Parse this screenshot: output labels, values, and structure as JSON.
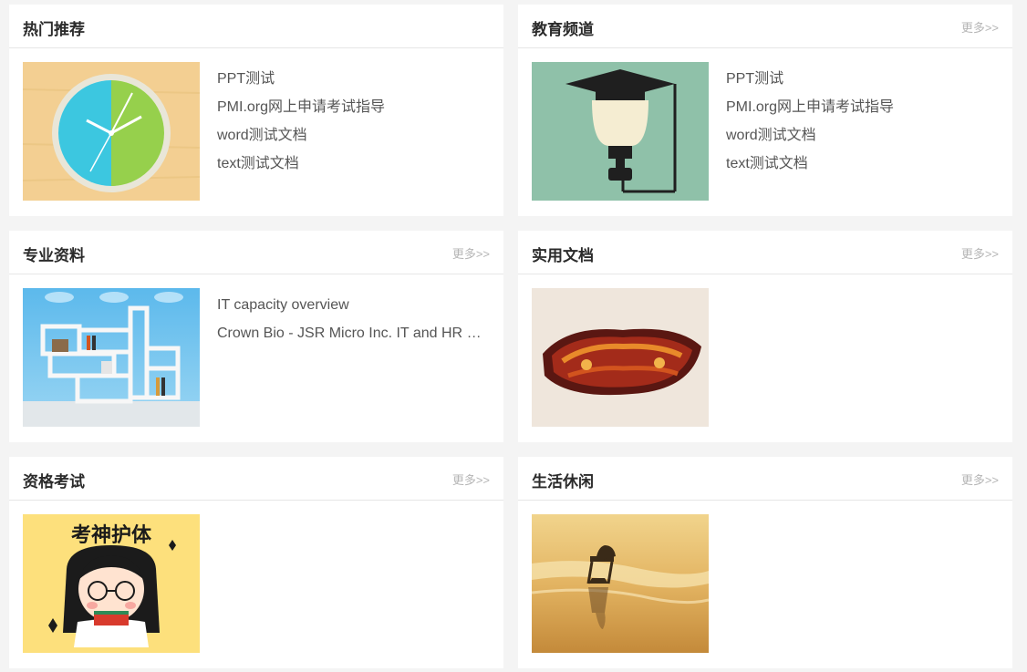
{
  "sections": [
    {
      "title": "热门推荐",
      "more": "",
      "image": "clock-illustration",
      "links": [
        "PPT测试",
        "PMI.org网上申请考试指导",
        "word测试文档",
        "text测试文档"
      ]
    },
    {
      "title": "教育频道",
      "more": "更多>>",
      "image": "graduation-cap-lightbulb-illustration",
      "links": [
        "PPT测试",
        "PMI.org网上申请考试指导",
        "word测试文档",
        "text测试文档"
      ]
    },
    {
      "title": "专业资料",
      "more": "更多>>",
      "image": "bookshelf-photo",
      "links": [
        "IT capacity overview",
        "Crown Bio - JSR Micro Inc. IT and HR Meeting"
      ]
    },
    {
      "title": "实用文档",
      "more": "更多>>",
      "image": "calligraphy-banner",
      "links": []
    },
    {
      "title": "资格考试",
      "more": "更多>>",
      "image": "exam-cartoon-girl",
      "image_caption": "考神护体",
      "links": []
    },
    {
      "title": "生活休闲",
      "more": "更多>>",
      "image": "beach-chair-sunset-photo",
      "links": []
    }
  ],
  "colors": {
    "page_background": "#f4f4f4",
    "card_background": "#ffffff",
    "title_text": "#2b2b2b",
    "link_text": "#555555",
    "more_text": "#b5b5b5"
  }
}
